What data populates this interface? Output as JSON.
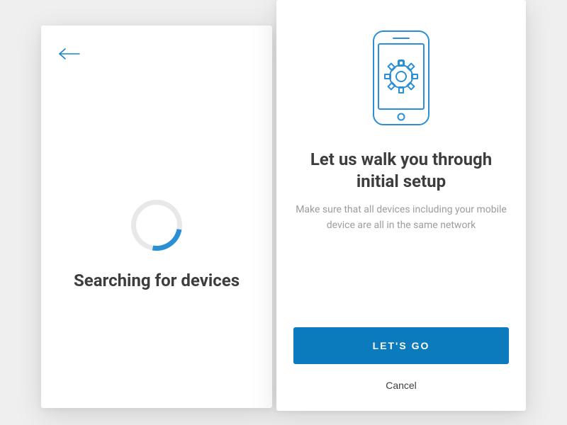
{
  "search_card": {
    "title": "Searching for devices"
  },
  "setup_card": {
    "title": "Let us walk you through initial setup",
    "subtitle": "Make sure that all devices including your mobile device are all in the same network",
    "primary_label": "LET'S GO",
    "cancel_label": "Cancel"
  },
  "colors": {
    "accent": "#0b7bbd",
    "accent_light": "#2a8fd4",
    "text_dark": "#3c3d3f",
    "text_muted": "#9a9c9e",
    "bg": "#efeff0"
  }
}
